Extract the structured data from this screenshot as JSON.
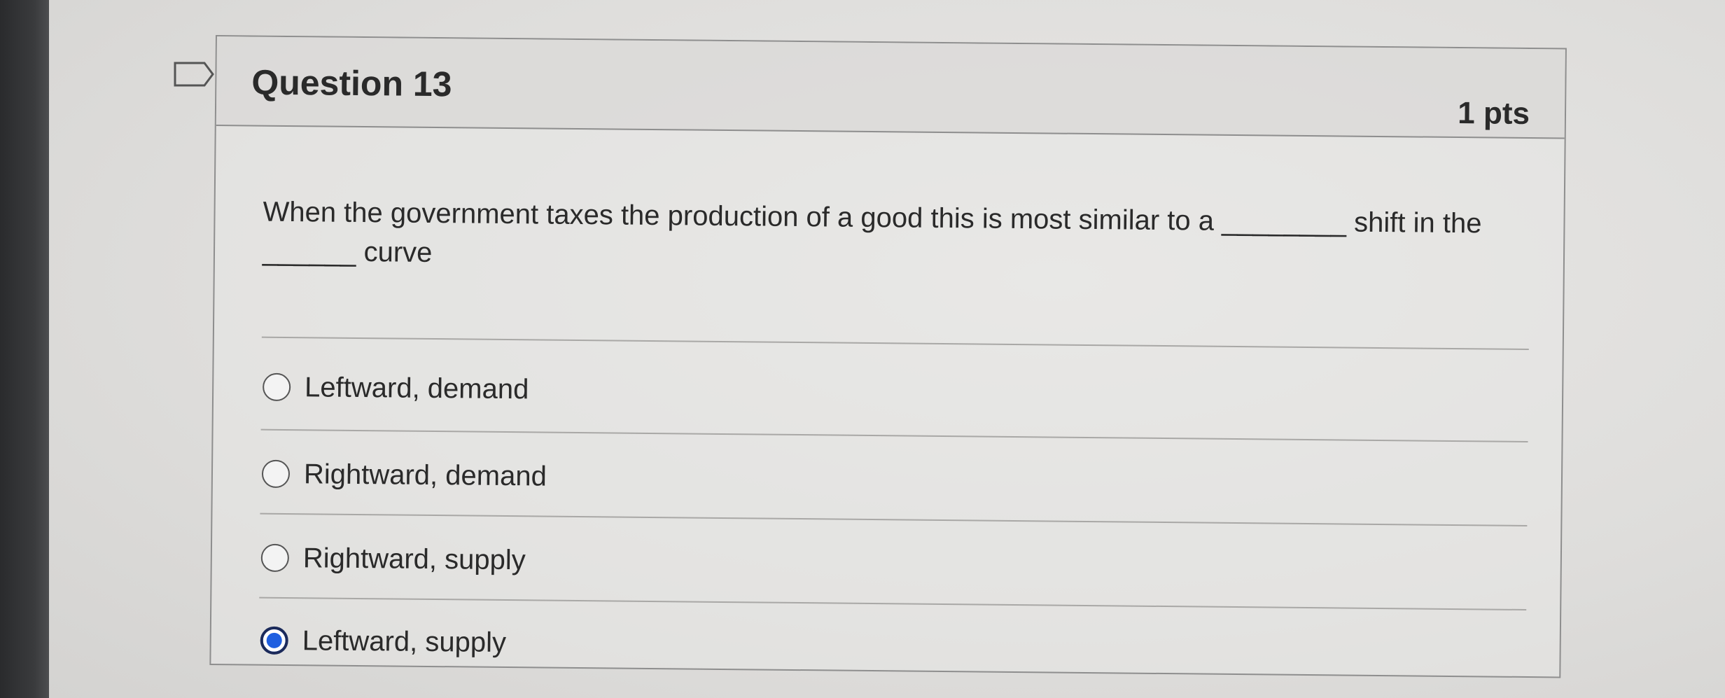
{
  "question": {
    "title": "Question 13",
    "points": "1 pts",
    "text": "When the government taxes the production of a good this is most similar to a ________ shift in the ______ curve"
  },
  "answers": [
    {
      "label": "Leftward, demand",
      "selected": false
    },
    {
      "label": "Rightward, demand",
      "selected": false
    },
    {
      "label": "Rightward, supply",
      "selected": false
    },
    {
      "label": "Leftward, supply",
      "selected": true
    }
  ],
  "colors": {
    "selected_radio": "#1f5fe0",
    "border": "#8e8e8e",
    "text": "#2a2a2a"
  },
  "icons": {
    "bookmark": "bookmark-flag-icon"
  }
}
